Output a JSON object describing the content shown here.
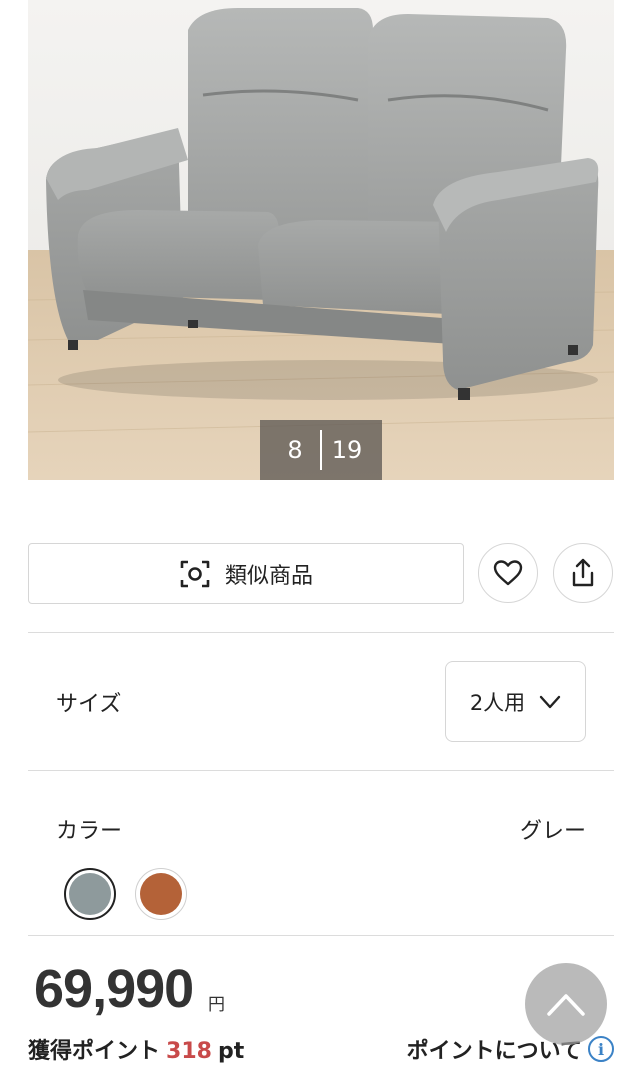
{
  "gallery": {
    "current": "8",
    "total": "19",
    "image_alt": "gray two-seater sofa"
  },
  "actions": {
    "similar_label": "類似商品",
    "similar_icon": "scan-icon",
    "favorite_icon": "heart-icon",
    "share_icon": "share-icon"
  },
  "size": {
    "label": "サイズ",
    "selected": "2人用"
  },
  "color": {
    "label": "カラー",
    "selected": "グレー",
    "swatches": [
      "#8e9a9c",
      "#b46238"
    ]
  },
  "price": {
    "amount": "69,990",
    "currency": "円"
  },
  "points": {
    "label": "獲得ポイント",
    "value": "318",
    "unit": "pt",
    "about": "ポイントについて"
  },
  "colors": {
    "points_accent": "#c84a4a",
    "info_blue": "#3b82c6"
  }
}
